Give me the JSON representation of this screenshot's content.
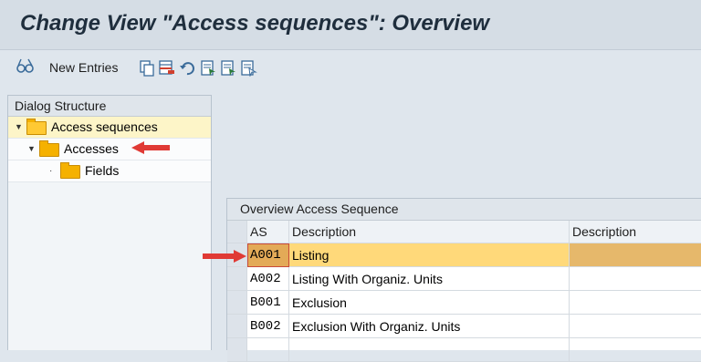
{
  "title": "Change View \"Access sequences\": Overview",
  "toolbar": {
    "new_entries_label": "New Entries",
    "icons": [
      "display-change-glasses-icon",
      "copy-icon",
      "delete-icon",
      "undo-icon",
      "select-all-icon",
      "select-block-icon",
      "deselect-all-icon"
    ]
  },
  "dialog_structure": {
    "header": "Dialog Structure",
    "items": [
      {
        "label": "Access sequences",
        "level": 0,
        "expanded": true,
        "selected": true
      },
      {
        "label": "Accesses",
        "level": 1,
        "expanded": true,
        "selected": false
      },
      {
        "label": "Fields",
        "level": 2,
        "expanded": false,
        "selected": false
      }
    ]
  },
  "overview": {
    "header": "Overview Access Sequence",
    "columns": [
      "AS",
      "Description",
      "Description"
    ],
    "rows": [
      {
        "as": "A001",
        "description": "Listing",
        "description2": "",
        "highlighted": true
      },
      {
        "as": "A002",
        "description": "Listing With Organiz. Units",
        "description2": "",
        "highlighted": false
      },
      {
        "as": "B001",
        "description": "Exclusion",
        "description2": "",
        "highlighted": false
      },
      {
        "as": "B002",
        "description": "Exclusion With Organiz. Units",
        "description2": "",
        "highlighted": false
      }
    ]
  },
  "colors": {
    "title_bar": "#d5dde5",
    "folder": "#f5b100",
    "highlight_row": "#ffd97a",
    "annotation_arrow": "#e03a35"
  }
}
